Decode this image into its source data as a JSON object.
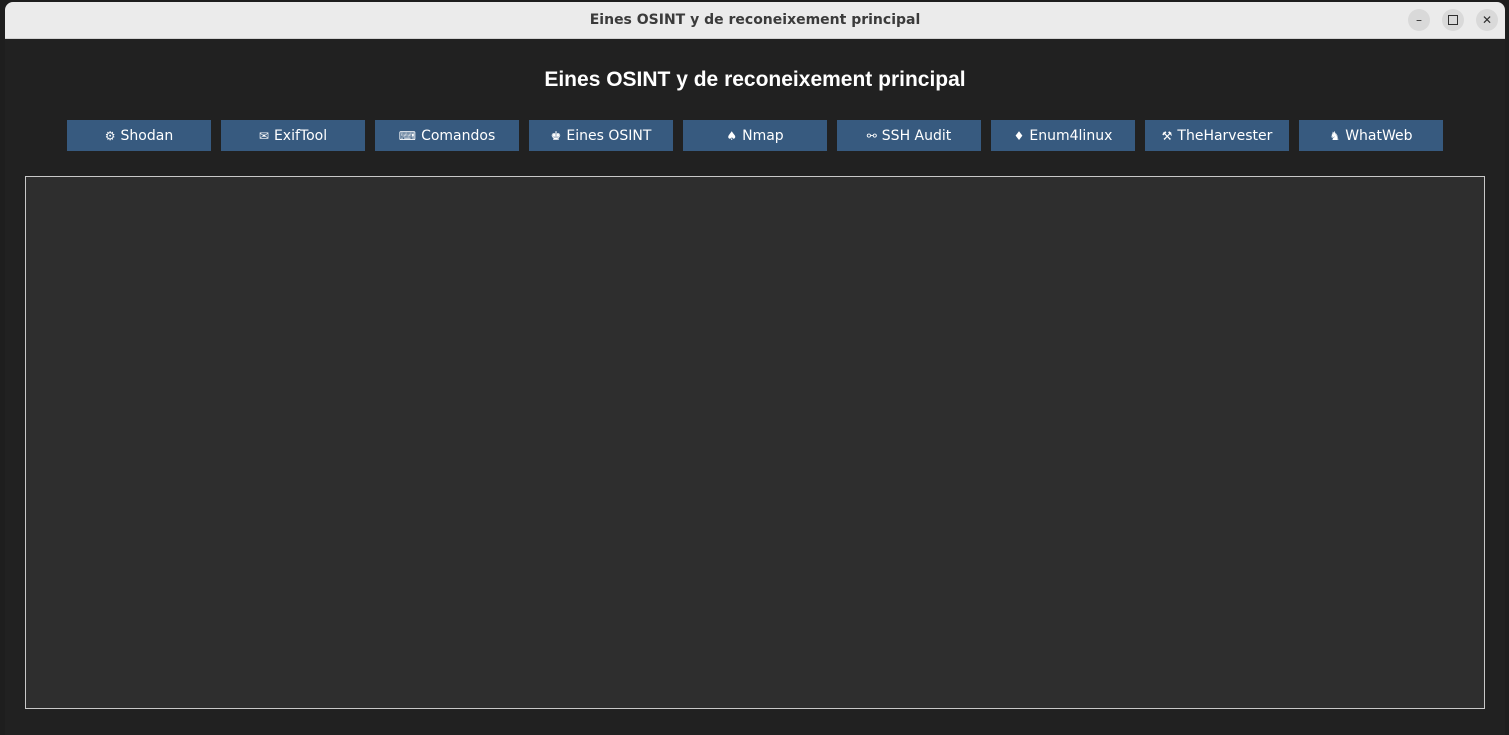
{
  "window": {
    "title": "Eines OSINT y de reconeixement principal",
    "controls": {
      "minimize": "–",
      "close": "✕"
    }
  },
  "main": {
    "heading": "Eines OSINT y de reconeixement principal",
    "toolbar": [
      {
        "icon": "⚙",
        "icon_name": "gear-icon",
        "label": "Shodan"
      },
      {
        "icon": "✉",
        "icon_name": "envelope-icon",
        "label": "ExifTool"
      },
      {
        "icon": "⌨",
        "icon_name": "keyboard-icon",
        "label": "Comandos"
      },
      {
        "icon": "♚",
        "icon_name": "chess-king-icon",
        "label": "Eines OSINT"
      },
      {
        "icon": "♠",
        "icon_name": "spade-icon",
        "label": "Nmap"
      },
      {
        "icon": "⚯",
        "icon_name": "link-icon",
        "label": "SSH Audit"
      },
      {
        "icon": "♦",
        "icon_name": "diamond-icon",
        "label": "Enum4linux"
      },
      {
        "icon": "⚒",
        "icon_name": "hammer-pick-icon",
        "label": "TheHarvester"
      },
      {
        "icon": "♞",
        "icon_name": "chess-knight-icon",
        "label": "WhatWeb"
      }
    ]
  },
  "colors": {
    "background": "#212121",
    "panel": "#2e2e2e",
    "button": "#375a7f",
    "text": "#ffffff"
  }
}
